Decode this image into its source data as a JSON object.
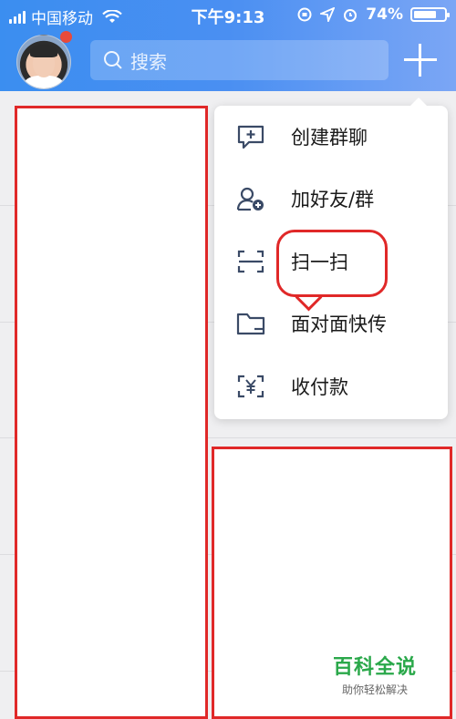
{
  "status_bar": {
    "carrier": "中国移动",
    "time": "下午9:13",
    "battery": "74%",
    "battery_level": 0.74
  },
  "header": {
    "search_placeholder": "搜索"
  },
  "menu": {
    "items": [
      {
        "label": "创建群聊",
        "icon": "chat-plus-icon"
      },
      {
        "label": "加好友/群",
        "icon": "add-friend-icon"
      },
      {
        "label": "扫一扫",
        "icon": "scan-icon"
      },
      {
        "label": "面对面快传",
        "icon": "folder-icon"
      },
      {
        "label": "收付款",
        "icon": "yuan-scan-icon"
      }
    ]
  },
  "watermark": {
    "title": "百科全说",
    "subtitle": "助你轻松解决"
  },
  "colors": {
    "header_start": "#3b8ef0",
    "header_end": "#7ba6f5",
    "highlight_red": "#e02828",
    "watermark_green": "#2aa84a"
  }
}
